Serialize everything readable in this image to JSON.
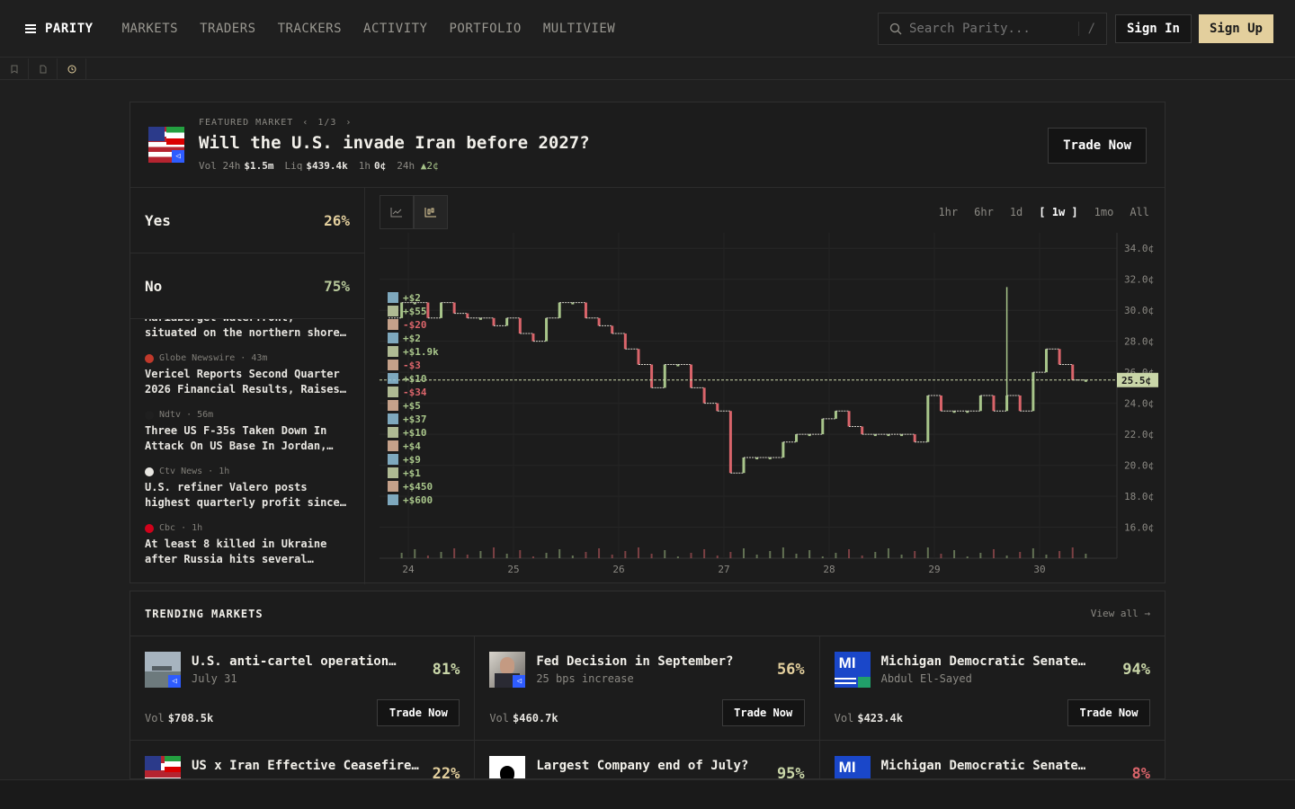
{
  "nav": {
    "brand": "PARITY",
    "links": [
      "MARKETS",
      "TRADERS",
      "TRACKERS",
      "ACTIVITY",
      "PORTFOLIO",
      "MULTIVIEW"
    ],
    "search_placeholder": "Search Parity...",
    "search_shortcut": "/",
    "signin_label": "Sign In",
    "signup_label": "Sign Up"
  },
  "substrip_icons": [
    "bookmark-icon",
    "document-icon",
    "history-icon"
  ],
  "featured": {
    "label": "FEATURED MARKET",
    "pager": "1/3",
    "title": "Will the U.S. invade Iran before 2027?",
    "stats": {
      "vol_label": "Vol 24h",
      "vol": "$1.5m",
      "liq_label": "Liq",
      "liq": "$439.4k",
      "h1_label": "1h",
      "h1": "0¢",
      "h24_label": "24h",
      "h24": "▲2¢"
    },
    "trade_label": "Trade Now",
    "outcomes": [
      {
        "name": "Yes",
        "pct": "26%",
        "color": "#e3cf9d"
      },
      {
        "name": "No",
        "pct": "75%",
        "color": "#b7c89a"
      }
    ],
    "news": [
      {
        "source": "",
        "time": "",
        "title": "Mariaberget waterfront, situated on the northern shore…",
        "dot": "#333333"
      },
      {
        "source": "Globe Newswire",
        "time": "43m",
        "title": "Vericel Reports Second Quarter 2026 Financial Results, Raises…",
        "dot": "#c0392b"
      },
      {
        "source": "Ndtv",
        "time": "56m",
        "title": "Three US F-35s Taken Down In Attack On US Base In Jordan,…",
        "dot": "#1f1f1f"
      },
      {
        "source": "Ctv News",
        "time": "1h",
        "title": "U.S. refiner Valero posts highest quarterly profit since…",
        "dot": "#e8e6e1"
      },
      {
        "source": "Cbc",
        "time": "1h",
        "title": "At least 8 killed in Ukraine after Russia hits several…",
        "dot": "#d0021b"
      }
    ],
    "ranges": [
      "1hr",
      "6hr",
      "1d",
      "1w",
      "1mo",
      "All"
    ],
    "selected_range": "1w",
    "current_price_label": "25.5¢"
  },
  "chart_data": {
    "type": "line",
    "xlabel": "",
    "ylabel": "",
    "x_ticks": [
      "24",
      "25",
      "26",
      "27",
      "28",
      "29",
      "30"
    ],
    "y_ticks": [
      "16.0¢",
      "18.0¢",
      "20.0¢",
      "22.0¢",
      "24.0¢",
      "26.0¢",
      "28.0¢",
      "30.0¢",
      "32.0¢",
      "34.0¢"
    ],
    "ylim": [
      14.0,
      35.0
    ],
    "current": 25.5,
    "series": [
      {
        "values": [
          29.5,
          30.5,
          30.5,
          29.5,
          30.5,
          29.8,
          29.5,
          29.5,
          29.0,
          29.5,
          28.5,
          28.0,
          29.5,
          30.5,
          30.5,
          29.5,
          29.0,
          28.5,
          27.5,
          26.5,
          25.0,
          26.5,
          26.5,
          25.0,
          24.0,
          23.5,
          19.5,
          20.5,
          20.5,
          20.5,
          21.5,
          22.0,
          22.0,
          23.0,
          23.5,
          22.5,
          22.0,
          22.0,
          22.0,
          22.0,
          21.5,
          24.5,
          23.5,
          23.5,
          23.5,
          24.5,
          23.5,
          24.5,
          23.5,
          26.0,
          27.5,
          26.5,
          25.5,
          25.5
        ]
      }
    ],
    "trades": [
      "+$2",
      "+$55",
      "-$20",
      "+$2",
      "+$1.9k",
      "-$3",
      "+$10",
      "-$34",
      "+$5",
      "+$37",
      "+$10",
      "+$4",
      "+$9",
      "+$1",
      "+$450",
      "+$600"
    ]
  },
  "trending": {
    "title": "TRENDING MARKETS",
    "view_all": "View all →",
    "vol_label": "Vol",
    "trade_label": "Trade Now",
    "markets": [
      {
        "title": "U.S. anti-cartel operation…",
        "sub": "July 31",
        "pct": "81%",
        "vol": "$708.5k",
        "color": "#c9d6a8",
        "img": "aircraft"
      },
      {
        "title": "Fed Decision in September?",
        "sub": "25 bps increase",
        "pct": "56%",
        "vol": "$460.7k",
        "color": "#e3cf9d",
        "img": "portrait"
      },
      {
        "title": "Michigan Democratic Senate…",
        "sub": "Abdul El-Sayed",
        "pct": "94%",
        "vol": "$423.4k",
        "color": "#c9d6a8",
        "img": "mi-logo"
      },
      {
        "title": "US x Iran Effective Ceasefire…",
        "sub": "",
        "pct": "22%",
        "vol": "",
        "color": "#e3cf9d",
        "img": "flags"
      },
      {
        "title": "Largest Company end of July?",
        "sub": "",
        "pct": "95%",
        "vol": "",
        "color": "#c9d6a8",
        "img": "apple"
      },
      {
        "title": "Michigan Democratic Senate…",
        "sub": "",
        "pct": "8%",
        "vol": "",
        "color": "#d9646a",
        "img": "mi-logo"
      }
    ]
  }
}
